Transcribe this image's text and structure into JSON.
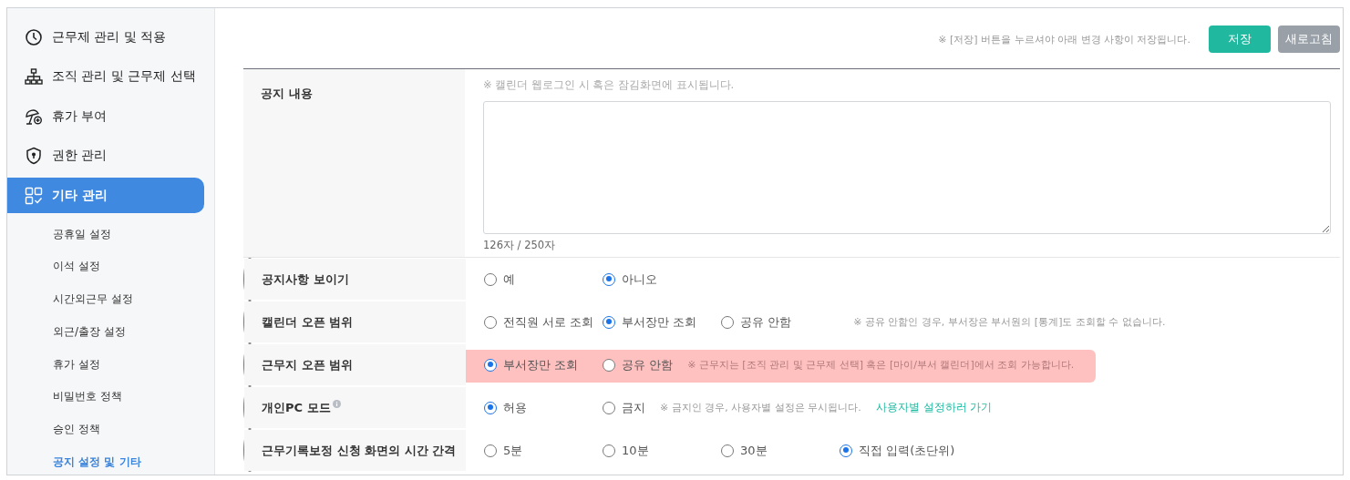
{
  "sidebar": {
    "items": [
      {
        "label": "근무제 관리 및 적용",
        "selected": false
      },
      {
        "label": "조직 관리 및 근무제 선택",
        "selected": false
      },
      {
        "label": "휴가 부여",
        "selected": false
      },
      {
        "label": "권한 관리",
        "selected": false
      },
      {
        "label": "기타 관리",
        "selected": true,
        "children": [
          {
            "label": "공휴일 설정",
            "selected": false
          },
          {
            "label": "이석 설정",
            "selected": false
          },
          {
            "label": "시간외근무 설정",
            "selected": false
          },
          {
            "label": "외근/출장 설정",
            "selected": false
          },
          {
            "label": "휴가 설정",
            "selected": false
          },
          {
            "label": "비밀번호 정책",
            "selected": false
          },
          {
            "label": "승인 정책",
            "selected": false
          },
          {
            "label": "공지 설정 및 기타",
            "selected": true
          }
        ]
      }
    ]
  },
  "toolbar": {
    "note": "※ [저장] 버튼을 누르셔야 아래 변경 사항이 저장됩니다.",
    "buttons": [
      {
        "label": "저장",
        "kind": "primary"
      },
      {
        "label": "새로고침",
        "kind": "secondary"
      }
    ]
  },
  "settings": [
    {
      "kind": "textarea",
      "label": "공지 내용",
      "hint": "※ 캘린더 웹로그인 시 혹은 잠김화면에 표시됩니다.",
      "counter": "126자 / 250자",
      "highlighted": false
    },
    {
      "kind": "radio",
      "label": "공지사항 보이기",
      "highlighted": false,
      "options": [
        {
          "label": "예",
          "selected": false
        },
        {
          "label": "아니오",
          "selected": true
        }
      ]
    },
    {
      "kind": "radio",
      "label": "캘린더 오픈 범위",
      "highlighted": false,
      "options": [
        {
          "label": "전직원 서로 조회",
          "selected": false
        },
        {
          "label": "부서장만 조회",
          "selected": true
        },
        {
          "label": "공유 안함",
          "selected": false
        }
      ],
      "note": "※ 공유 안함인 경우, 부서장은 부서원의 [통계]도 조회할 수 없습니다.",
      "note_gap": true
    },
    {
      "kind": "radio",
      "label": "근무지 오픈 범위",
      "highlighted": true,
      "options": [
        {
          "label": "부서장만 조회",
          "selected": true
        },
        {
          "label": "공유 안함",
          "selected": false
        }
      ],
      "note": "※ 근무지는 [조직 관리 및 근무제 선택] 혹은 [마이/부서 캘린더]에서 조회 가능합니다."
    },
    {
      "kind": "radio",
      "label": "개인PC 모드",
      "info": true,
      "highlighted": false,
      "options": [
        {
          "label": "허용",
          "selected": true
        },
        {
          "label": "금지",
          "selected": false
        }
      ],
      "note": "※ 금지인 경우, 사용자별 설정은 무시됩니다.",
      "link": "사용자별 설정하러 가기"
    },
    {
      "kind": "radio",
      "label": "근무기록보정 신청 화면의 시간 간격",
      "highlighted": false,
      "options": [
        {
          "label": "5분",
          "selected": false
        },
        {
          "label": "10분",
          "selected": false
        },
        {
          "label": "30분",
          "selected": false
        },
        {
          "label": "직접 입력(초단위)",
          "selected": true
        }
      ]
    }
  ]
}
